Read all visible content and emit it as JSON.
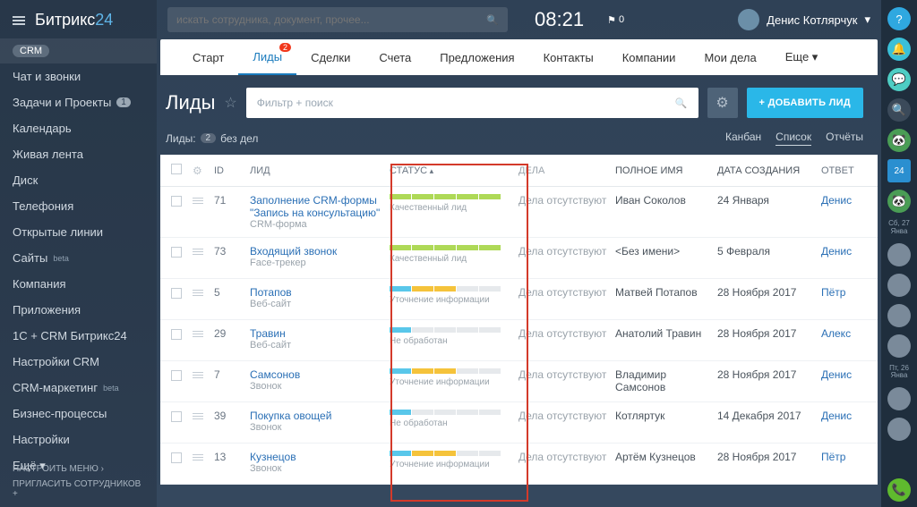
{
  "logo": {
    "part1": "Битрикс",
    "part2": "24"
  },
  "sidebar": {
    "items": [
      {
        "label": "CRM",
        "pill": true
      },
      {
        "label": "Чат и звонки"
      },
      {
        "label": "Задачи и Проекты",
        "count": "1"
      },
      {
        "label": "Календарь"
      },
      {
        "label": "Живая лента"
      },
      {
        "label": "Диск"
      },
      {
        "label": "Телефония"
      },
      {
        "label": "Открытые линии"
      },
      {
        "label": "Сайты",
        "beta": "beta"
      },
      {
        "label": "Компания"
      },
      {
        "label": "Приложения"
      },
      {
        "label": "1С + CRM Битрикс24"
      },
      {
        "label": "Настройки CRM"
      },
      {
        "label": "CRM-маркетинг",
        "beta": "beta"
      },
      {
        "label": "Бизнес-процессы"
      },
      {
        "label": "Настройки"
      },
      {
        "label": "Ещё ▾"
      }
    ],
    "footer1": "НАСТРОИТЬ МЕНЮ ›",
    "footer2": "ПРИГЛАСИТЬ СОТРУДНИКОВ +"
  },
  "search": {
    "placeholder": "искать сотрудника, документ, прочее..."
  },
  "clock": "08:21",
  "flag_count": "0",
  "user_name": "Денис Котлярчук",
  "tabs": [
    {
      "label": "Старт"
    },
    {
      "label": "Лиды",
      "badge": "2"
    },
    {
      "label": "Сделки"
    },
    {
      "label": "Счета"
    },
    {
      "label": "Предложения"
    },
    {
      "label": "Контакты"
    },
    {
      "label": "Компании"
    },
    {
      "label": "Мои дела"
    },
    {
      "label": "Еще ▾"
    }
  ],
  "page_title": "Лиды",
  "filter_placeholder": "Фильтр + поиск",
  "add_button": "+ ДОБАВИТЬ ЛИД",
  "subheader": {
    "label": "Лиды:",
    "count": "2",
    "suffix": "без дел"
  },
  "views": [
    {
      "label": "Канбан"
    },
    {
      "label": "Список"
    },
    {
      "label": "Отчёты"
    }
  ],
  "columns": {
    "id": "ID",
    "lead": "ЛИД",
    "status": "СТАТУС",
    "deal": "ДЕЛА",
    "name": "ПОЛНОЕ ИМЯ",
    "date": "ДАТА СОЗДАНИЯ",
    "resp": "ОТВЕТ"
  },
  "no_deals": "Дела отсутствуют",
  "rows": [
    {
      "id": "71",
      "title": "Заполнение CRM-формы \"Запись на консультацию\"",
      "sub": "CRM-форма",
      "segs": [
        "g",
        "g",
        "g",
        "g",
        "g"
      ],
      "status": "Качественный лид",
      "name": "Иван Соколов",
      "date": "24 Января",
      "resp": "Денис"
    },
    {
      "id": "73",
      "title": "Входящий звонок",
      "sub": "Face-трекер",
      "segs": [
        "g",
        "g",
        "g",
        "g",
        "g"
      ],
      "status": "Качественный лид",
      "name": "<Без имени>",
      "date": "5 Февраля",
      "resp": "Денис"
    },
    {
      "id": "5",
      "title": "Потапов",
      "sub": "Веб-сайт",
      "segs": [
        "b",
        "y",
        "y",
        "",
        ""
      ],
      "status": "Уточнение информации",
      "name": "Матвей Потапов",
      "date": "28 Ноября 2017",
      "resp": "Пётр"
    },
    {
      "id": "29",
      "title": "Травин",
      "sub": "Веб-сайт",
      "segs": [
        "b",
        "",
        "",
        "",
        ""
      ],
      "status": "Не обработан",
      "name": "Анатолий Травин",
      "date": "28 Ноября 2017",
      "resp": "Алекс"
    },
    {
      "id": "7",
      "title": "Самсонов",
      "sub": "Звонок",
      "segs": [
        "b",
        "y",
        "y",
        "",
        ""
      ],
      "status": "Уточнение информации",
      "name": "Владимир Самсонов",
      "date": "28 Ноября 2017",
      "resp": "Денис"
    },
    {
      "id": "39",
      "title": "Покупка овощей",
      "sub": "Звонок",
      "segs": [
        "b",
        "",
        "",
        "",
        ""
      ],
      "status": "Не обработан",
      "name": "Котляртук",
      "date": "14 Декабря 2017",
      "resp": "Денис"
    },
    {
      "id": "13",
      "title": "Кузнецов",
      "sub": "Звонок",
      "segs": [
        "b",
        "y",
        "y",
        "",
        ""
      ],
      "status": "Уточнение информации",
      "name": "Артём Кузнецов",
      "date": "28 Ноября 2017",
      "resp": "Пётр"
    }
  ],
  "rail_dates": [
    "Сб, 27 Янва",
    "Пт, 26 Янва"
  ]
}
